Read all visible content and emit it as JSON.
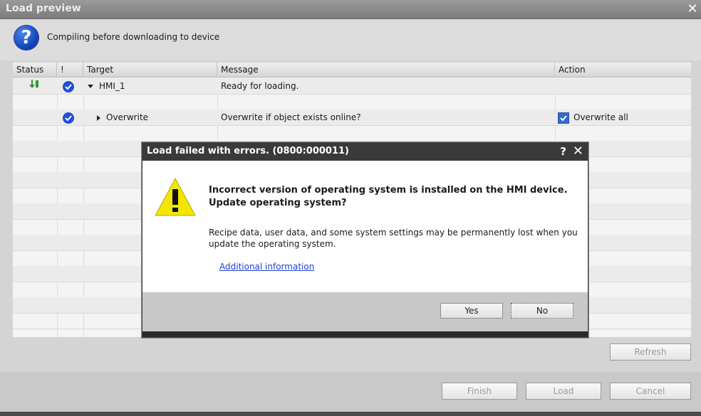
{
  "window": {
    "title": "Load preview",
    "close": "✕"
  },
  "header": {
    "text": "Compiling before downloading to device"
  },
  "table": {
    "columns": [
      "Status",
      "!",
      "Target",
      "Message",
      "Action"
    ],
    "rows": [
      {
        "target": "HMI_1",
        "message": "Ready for loading.",
        "action": ""
      },
      {
        "target": "Overwrite",
        "message": "Overwrite if object exists online?",
        "action": "Overwrite all"
      }
    ]
  },
  "buttons": {
    "refresh": "Refresh",
    "finish": "Finish",
    "load": "Load",
    "cancel": "Cancel"
  },
  "dialog": {
    "title": "Load failed with errors. (0800:000011)",
    "help": "?",
    "close": "✕",
    "main_message": "Incorrect version of operating system is installed on the HMI device. Update operating system?",
    "sub_message": "Recipe data, user data, and some system settings may be permanently lost when you update the operating system.",
    "link": "Additional information",
    "yes": "Yes",
    "no": "No"
  },
  "colors": {
    "accent": "#1f4fd9",
    "warning": "#f2e600",
    "titlebar": "#3a3a3a"
  }
}
